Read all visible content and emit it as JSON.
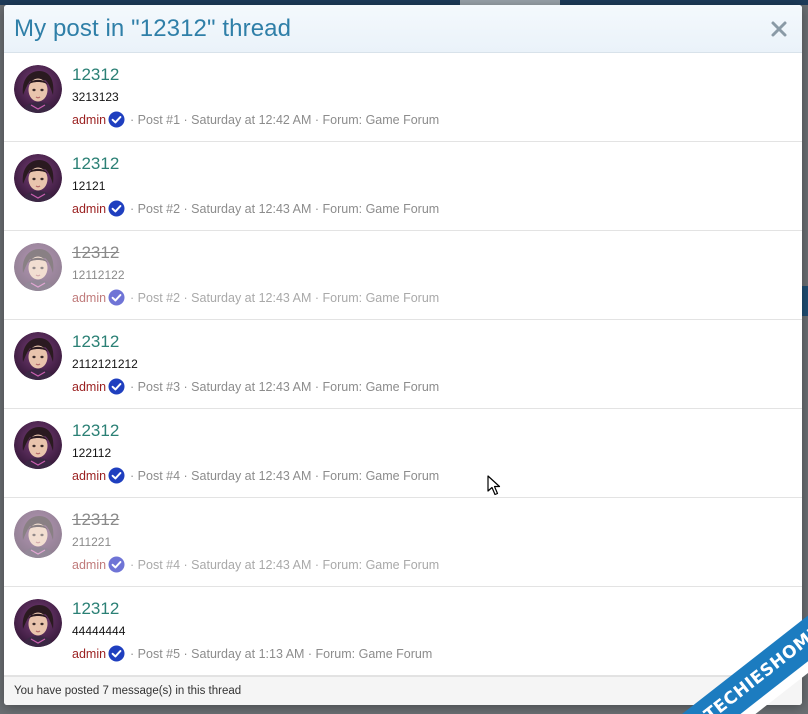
{
  "modal": {
    "title": "My post in \"12312\" thread",
    "close_icon": "close-icon"
  },
  "posts": [
    {
      "title": "12312",
      "snippet": "3213123",
      "author": "admin",
      "meta": "· Post #1 · Saturday at 12:42 AM · Forum: Game Forum",
      "deleted": false
    },
    {
      "title": "12312",
      "snippet": "12121",
      "author": "admin",
      "meta": "· Post #2 · Saturday at 12:43 AM · Forum: Game Forum",
      "deleted": false
    },
    {
      "title": "12312",
      "snippet": "12112122",
      "author": "admin",
      "meta": "· Post #2 · Saturday at 12:43 AM · Forum: Game Forum",
      "deleted": true
    },
    {
      "title": "12312",
      "snippet": "2112121212",
      "author": "admin",
      "meta": "· Post #3 · Saturday at 12:43 AM · Forum: Game Forum",
      "deleted": false
    },
    {
      "title": "12312",
      "snippet": "122112",
      "author": "admin",
      "meta": "· Post #4 · Saturday at 12:43 AM · Forum: Game Forum",
      "deleted": false
    },
    {
      "title": "12312",
      "snippet": "211221",
      "author": "admin",
      "meta": "· Post #4 · Saturday at 12:43 AM · Forum: Game Forum",
      "deleted": true
    },
    {
      "title": "12312",
      "snippet": "44444444",
      "author": "admin",
      "meta": "· Post #5 · Saturday at 1:13 AM · Forum: Game Forum",
      "deleted": false
    }
  ],
  "footer": {
    "text": "You have posted 7 message(s) in this thread"
  },
  "watermark": {
    "text": "TECHIESHOME.COM"
  },
  "colors": {
    "title": "#2f7fa8",
    "link": "#2b8075",
    "author": "#9a1f1f",
    "verified": "#1f3fbf"
  }
}
